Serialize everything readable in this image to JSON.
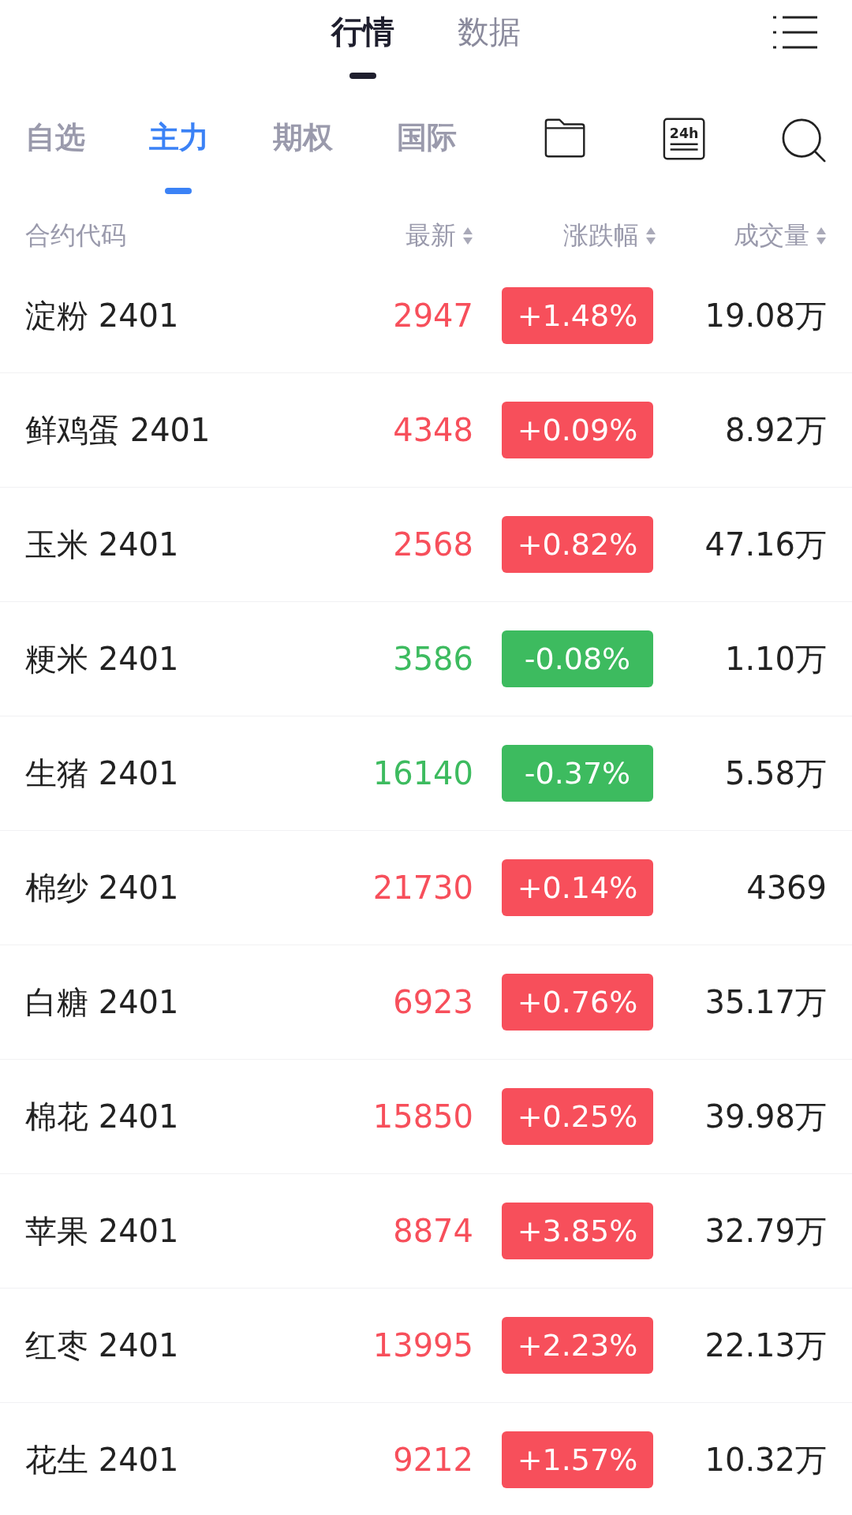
{
  "top_tabs": [
    {
      "label": "行情",
      "selected": true
    },
    {
      "label": "数据",
      "selected": false
    }
  ],
  "sub_tabs": [
    {
      "label": "自选",
      "selected": false
    },
    {
      "label": "主力",
      "selected": true
    },
    {
      "label": "期权",
      "selected": false
    },
    {
      "label": "国际",
      "selected": false
    }
  ],
  "news_icon_label": "24h",
  "columns": [
    "合约代码",
    "最新",
    "涨跌幅",
    "成交量"
  ],
  "rows": [
    {
      "name": "淀粉 2401",
      "price": "2947",
      "change": "+1.48%",
      "volume": "19.08万",
      "color": "#f74f5b"
    },
    {
      "name": "鲜鸡蛋 2401",
      "price": "4348",
      "change": "+0.09%",
      "volume": "8.92万",
      "color": "#f74f5b"
    },
    {
      "name": "玉米 2401",
      "price": "2568",
      "change": "+0.82%",
      "volume": "47.16万",
      "color": "#f74f5b"
    },
    {
      "name": "粳米 2401",
      "price": "3586",
      "change": "-0.08%",
      "volume": "1.10万",
      "color": "#3dbb5f"
    },
    {
      "name": "生猪 2401",
      "price": "16140",
      "change": "-0.37%",
      "volume": "5.58万",
      "color": "#3dbb5f"
    },
    {
      "name": "棉纱 2401",
      "price": "21730",
      "change": "+0.14%",
      "volume": "4369",
      "color": "#f74f5b"
    },
    {
      "name": "白糖 2401",
      "price": "6923",
      "change": "+0.76%",
      "volume": "35.17万",
      "color": "#f74f5b"
    },
    {
      "name": "棉花 2401",
      "price": "15850",
      "change": "+0.25%",
      "volume": "39.98万",
      "color": "#f74f5b"
    },
    {
      "name": "苹果 2401",
      "price": "8874",
      "change": "+3.85%",
      "volume": "32.79万",
      "color": "#f74f5b"
    },
    {
      "name": "红枣 2401",
      "price": "13995",
      "change": "+2.23%",
      "volume": "22.13万",
      "color": "#f74f5b"
    },
    {
      "name": "花生 2401",
      "price": "9212",
      "change": "+1.57%",
      "volume": "10.32万",
      "color": "#f74f5b"
    }
  ]
}
